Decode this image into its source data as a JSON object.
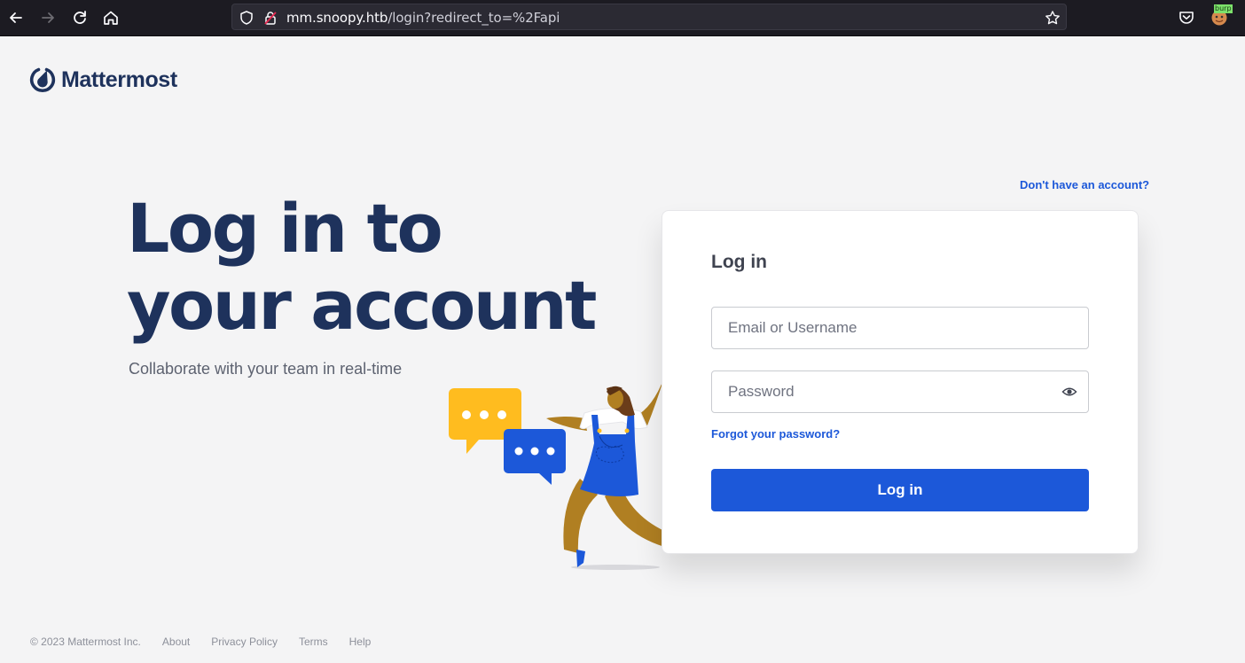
{
  "browser": {
    "url_host": "mm.snoopy.htb",
    "url_path": "/login?redirect_to=%2Fapi",
    "icons": [
      "back-icon",
      "forward-icon",
      "reload-icon",
      "home-icon",
      "shield-icon",
      "insecure-lock-icon",
      "bookmark-star-icon",
      "pocket-icon",
      "burp-extension-icon"
    ],
    "burp_badge": "burp"
  },
  "brand": {
    "name": "Mattermost",
    "color": "#1e325c",
    "accent": "#1c58d9"
  },
  "hero": {
    "title_line1": "Log in to",
    "title_line2": "your account",
    "subtitle": "Collaborate with your team in real-time"
  },
  "signup_link": "Don't have an account?",
  "login_card": {
    "title": "Log in",
    "username_placeholder": "Email or Username",
    "username_value": "",
    "password_placeholder": "Password",
    "password_value": "",
    "forgot_link": "Forgot your password?",
    "submit_label": "Log in"
  },
  "footer": {
    "copyright": "© 2023 Mattermost Inc.",
    "links": [
      "About",
      "Privacy Policy",
      "Terms",
      "Help"
    ]
  }
}
